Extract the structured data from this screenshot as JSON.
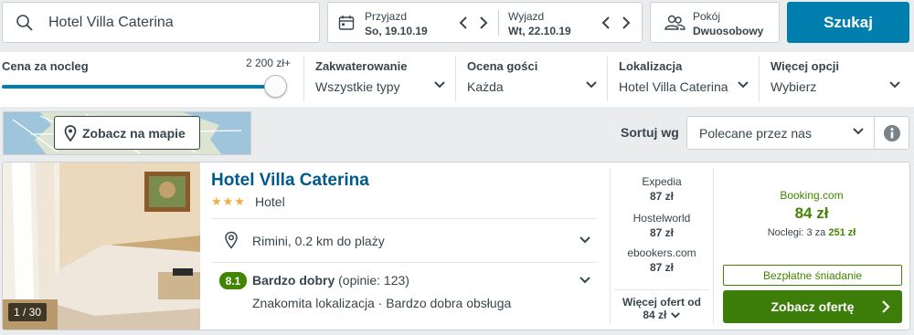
{
  "search": {
    "destination": "Hotel Villa Caterina",
    "checkin_label": "Przyjazd",
    "checkin_date": "So, 19.10.19",
    "checkout_label": "Wyjazd",
    "checkout_date": "Wt, 22.10.19",
    "rooms_label": "Pokój",
    "rooms_value": "Dwuosobowy",
    "submit_label": "Szukaj"
  },
  "filters": {
    "price": {
      "title": "Cena za nocleg",
      "max_label": "2 200 zł+",
      "slider_level_pct": 100
    },
    "accommodation": {
      "title": "Zakwaterowanie",
      "value": "Wszystkie typy"
    },
    "guest_rating": {
      "title": "Ocena gości",
      "value": "Każda"
    },
    "location": {
      "title": "Lokalizacja",
      "value": "Hotel Villa Caterina"
    },
    "more": {
      "title": "Więcej opcji",
      "value": "Wybierz"
    }
  },
  "map": {
    "button_label": "Zobacz na mapie"
  },
  "sort": {
    "label": "Sortuj wg",
    "value": "Polecane przez nas"
  },
  "result": {
    "image_counter": "1 / 30",
    "name": "Hotel Villa Caterina",
    "stars": "★★★",
    "type": "Hotel",
    "location": "Rimini, 0.2 km do plaży",
    "rating_score": "8.1",
    "rating_text": "Bardzo dobry",
    "rating_reviews": "(opinie: 123)",
    "rating_summary": "Znakomita lokalizacja · Bardzo dobra obsługa",
    "offers": [
      {
        "provider": "Expedia",
        "price": "87 zł"
      },
      {
        "provider": "Hostelworld",
        "price": "87 zł"
      },
      {
        "provider": "ebookers.com",
        "price": "87 zł"
      }
    ],
    "more_offers_label": "Więcej ofert od",
    "more_offers_price": "84 zł",
    "deal": {
      "provider": "Booking.com",
      "price": "84 zł",
      "nights_prefix": "Noclegi: 3 za",
      "nights_total": "251 zł",
      "badge": "Bezpłatne śniadanie",
      "button_label": "Zobacz ofertę"
    }
  },
  "colors": {
    "brand_blue": "#007faf",
    "title_blue": "#00598a",
    "deal_green": "#428500",
    "star_orange": "#f6ab3f"
  }
}
